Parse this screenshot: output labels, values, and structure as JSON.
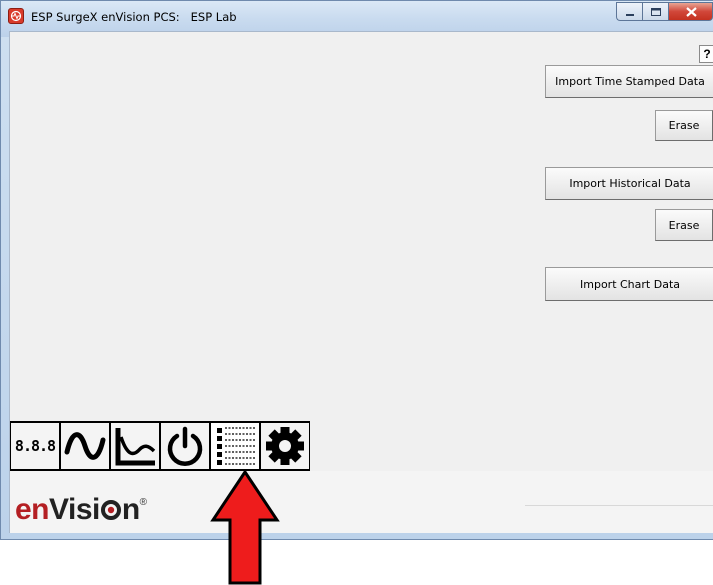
{
  "window": {
    "title": "ESP SurgeX enVision PCS:   ESP Lab",
    "minimize_label": "—",
    "maximize_label": "□",
    "close_label": "✕"
  },
  "help": {
    "label": "?"
  },
  "buttons": {
    "import_time_stamped": "Import Time Stamped Data",
    "erase_1": "Erase",
    "import_historical": "Import Historical Data",
    "erase_2": "Erase",
    "import_chart": "Import Chart Data"
  },
  "toolbar": {
    "items": [
      {
        "name": "meter-display",
        "label": "8.8.8",
        "icon": "seven-segment-icon"
      },
      {
        "name": "waveform",
        "icon": "sine-wave-icon"
      },
      {
        "name": "chart",
        "icon": "line-chart-icon"
      },
      {
        "name": "power",
        "icon": "power-icon"
      },
      {
        "name": "log-list",
        "icon": "list-icon",
        "selected": true
      },
      {
        "name": "settings",
        "icon": "gear-icon"
      }
    ]
  },
  "logo": {
    "prefix": "en",
    "main": "Visi",
    "tail": "n",
    "registered": "®"
  },
  "colors": {
    "brand_red": "#b41f23",
    "arrow_red": "#ee1c1c",
    "client_bg": "#f0f0f0"
  }
}
